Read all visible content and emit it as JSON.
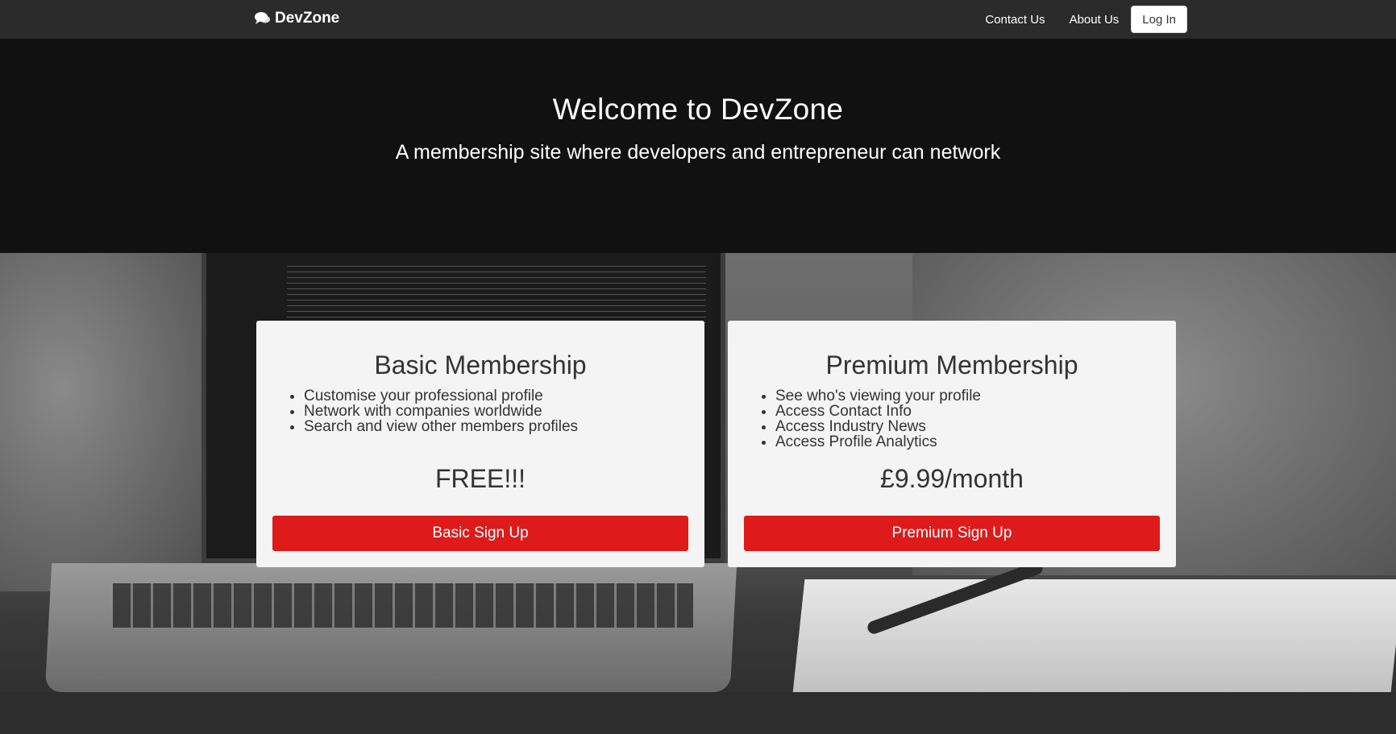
{
  "navbar": {
    "brand": "DevZone",
    "links": [
      "Contact Us",
      "About Us"
    ],
    "login_label": "Log In"
  },
  "hero": {
    "title": "Welcome to DevZone",
    "subtitle": "A membership site where developers and entrepreneur can network"
  },
  "plans": {
    "basic": {
      "title": "Basic Membership",
      "features": [
        "Customise your professional profile",
        "Network with companies worldwide",
        "Search and view other members profiles"
      ],
      "price": "FREE!!!",
      "button": "Basic Sign Up"
    },
    "premium": {
      "title": "Premium Membership",
      "features": [
        "See who's viewing your profile",
        "Access Contact Info",
        "Access Industry News",
        "Access Profile Analytics"
      ],
      "price": "£9.99/month",
      "button": "Premium Sign Up"
    }
  },
  "colors": {
    "navbar": "#2b2b2b",
    "hero": "#111111",
    "accent": "#de1a1a"
  },
  "icons": {
    "brand": "comments-icon"
  }
}
